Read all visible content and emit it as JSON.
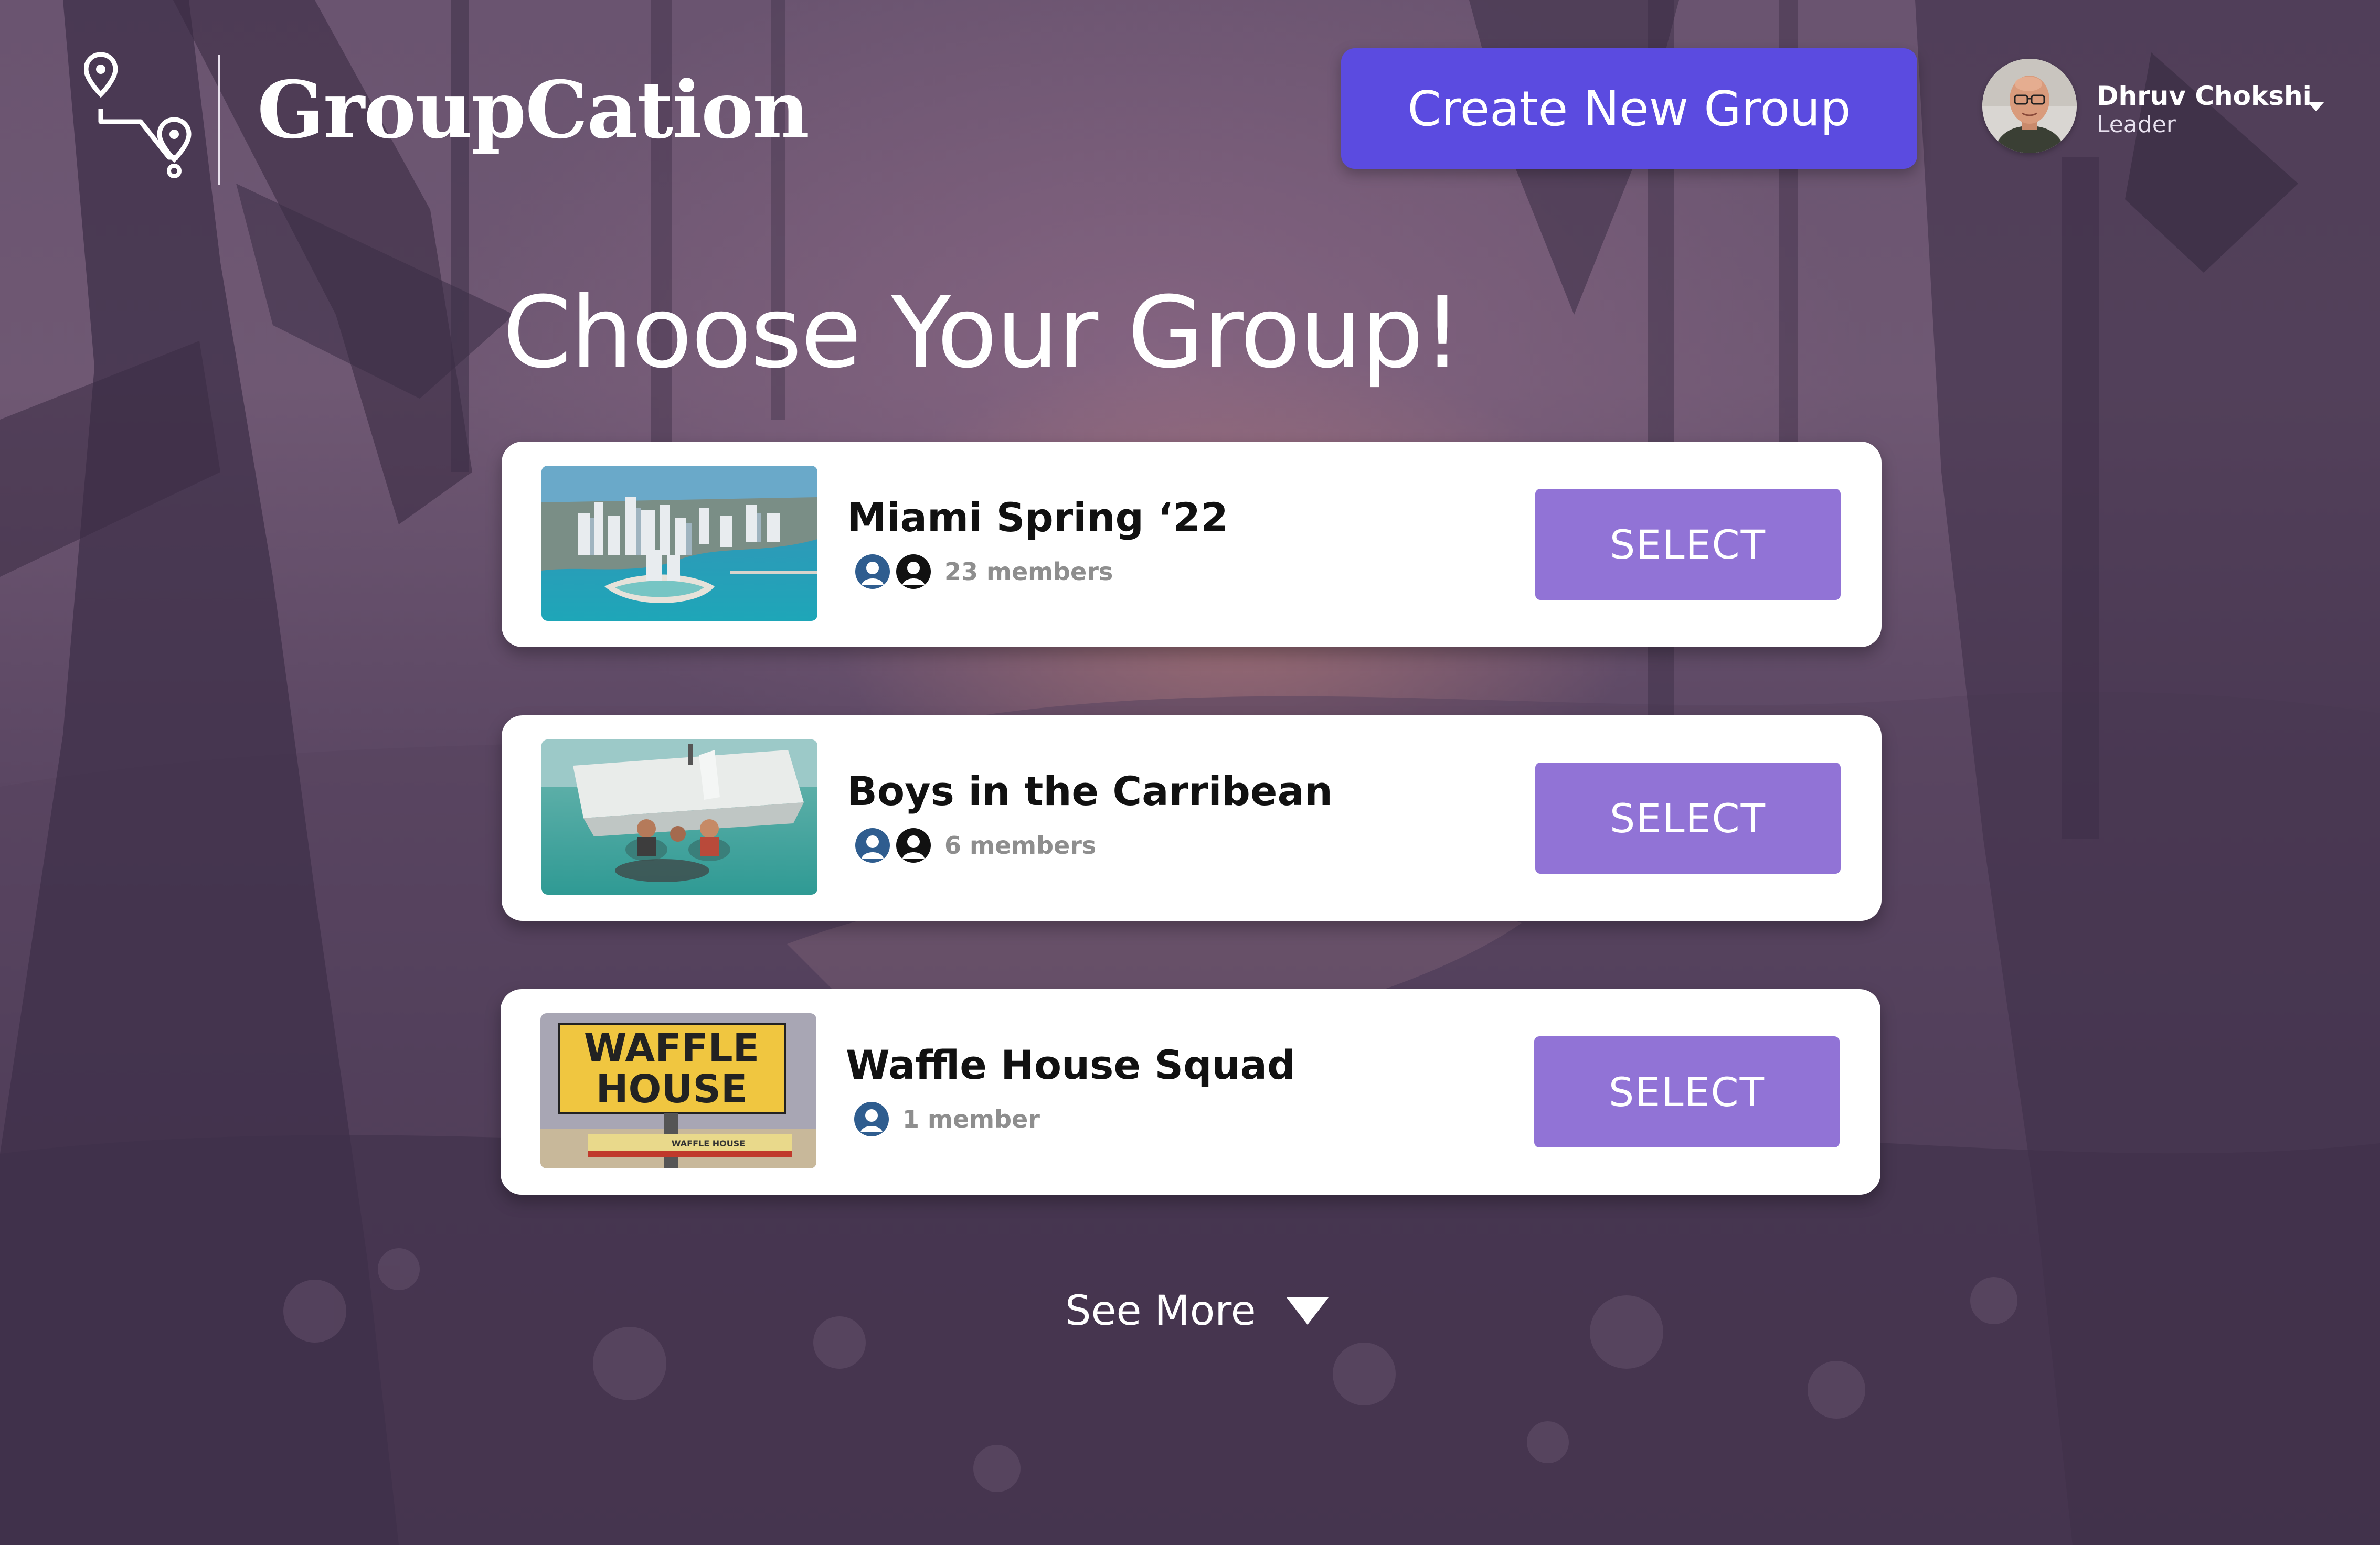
{
  "app": {
    "brand": "GroupCation",
    "logo_icon": "route-pin-icon"
  },
  "header": {
    "create_button_label": "Create New Group",
    "user": {
      "name": "Dhruv Chokshi",
      "role": "Leader",
      "menu_icon": "chevron-down-icon"
    }
  },
  "main": {
    "title": "Choose Your Group!",
    "groups": [
      {
        "name": "Miami Spring ‘22",
        "members_label": "23 members",
        "member_avatars": 2,
        "thumbnail": "miami-skyline-aerial",
        "select_label": "SELECT"
      },
      {
        "name": "Boys in the Carribean",
        "members_label": "6 members",
        "member_avatars": 2,
        "thumbnail": "catamaran-snorkeling",
        "select_label": "SELECT"
      },
      {
        "name": "Waffle House Squad",
        "members_label": "1 member",
        "member_avatars": 1,
        "thumbnail": "waffle-house-sign",
        "select_label": "SELECT"
      }
    ],
    "see_more_label": "See More"
  },
  "thumb_text": {
    "waffle_line1": "WAFFLE",
    "waffle_line2": "HOUSE",
    "waffle_small": "WAFFLE HOUSE"
  },
  "colors": {
    "primary": "#5b4be0",
    "select": "#9173d6",
    "background": "#4a3a57",
    "member_icon_blue": "#2f5d8f",
    "member_icon_black": "#111111"
  }
}
